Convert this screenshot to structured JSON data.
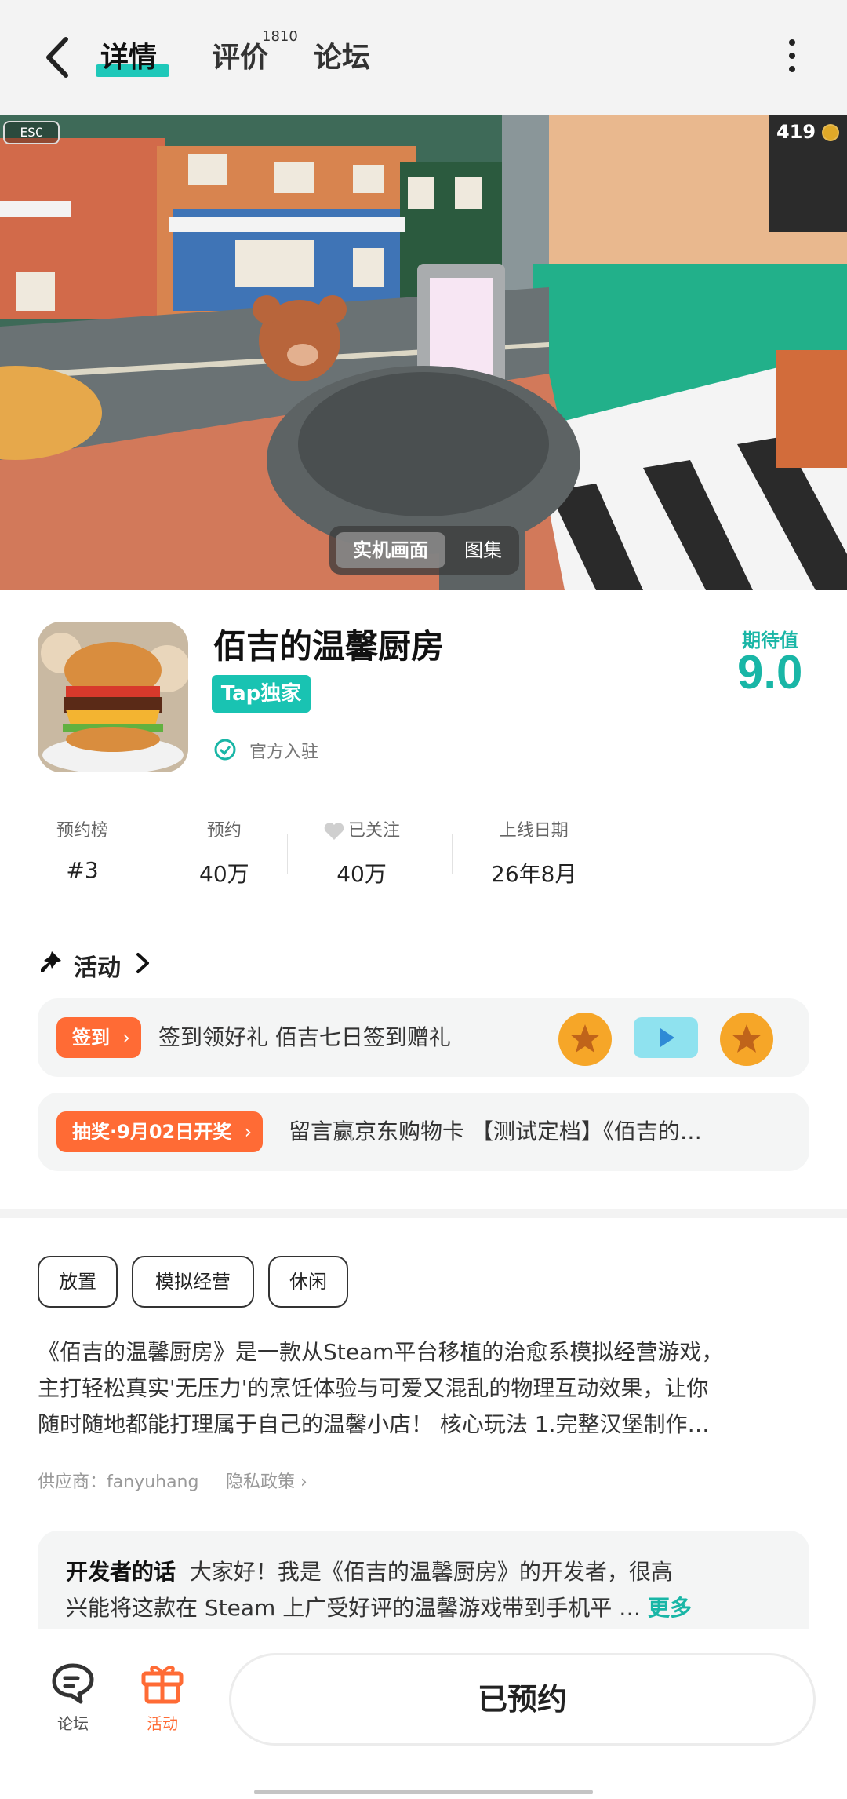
{
  "header": {
    "tabs": [
      {
        "label": "详情",
        "active": true
      },
      {
        "label": "评价",
        "badge": "1810"
      },
      {
        "label": "论坛"
      }
    ]
  },
  "hero": {
    "esc_label": "ESC",
    "coin_count": "419",
    "media_tabs": [
      {
        "label": "实机画面",
        "active": true
      },
      {
        "label": "图集",
        "active": false
      }
    ]
  },
  "game": {
    "title": "佰吉的温馨厨房",
    "badge": "Tap独家",
    "verified": "官方入驻",
    "expect_label": "期待值",
    "expect_value": "9.0"
  },
  "stats": [
    {
      "label": "预约榜",
      "value": "#3"
    },
    {
      "label": "预约",
      "value": "40万"
    },
    {
      "label": "已关注",
      "value": "40万"
    },
    {
      "label": "上线日期",
      "value": "26年8月"
    }
  ],
  "activity": {
    "title": "活动",
    "items": [
      {
        "tag": "签到",
        "text": "签到领好礼 佰吉七日签到赠礼"
      },
      {
        "tag": "抽奖·9月02日开奖",
        "text": "留言赢京东购物卡 【测试定档】《佰吉的…"
      }
    ]
  },
  "tags": [
    "放置",
    "模拟经营",
    "休闲"
  ],
  "description": {
    "lines": [
      "《佰吉的温馨厨房》是一款从Steam平台移植的治愈系模拟经营游戏，",
      "主打轻松真实'无压力'的烹饪体验与可爱又混乱的物理互动效果，让你",
      "随时随地都能打理属于自己的温馨小店！ 核心玩法 1.完整汉堡制作…"
    ],
    "provider": "供应商：fanyuhang",
    "privacy": "隐私政策"
  },
  "developer": {
    "label": "开发者的话",
    "line1": "大家好！我是《佰吉的温馨厨房》的开发者，很高",
    "line2": "兴能将这款在 Steam 上广受好评的温馨游戏带到手机平 …",
    "more": "更多"
  },
  "bottom": {
    "nav": [
      {
        "label": "论坛",
        "icon": "chat-icon"
      },
      {
        "label": "活动",
        "icon": "gift-icon",
        "active": true
      }
    ],
    "reserve_label": "已预约"
  },
  "colors": {
    "accent_teal": "#19b6a6",
    "accent_orange": "#ff6b35"
  }
}
